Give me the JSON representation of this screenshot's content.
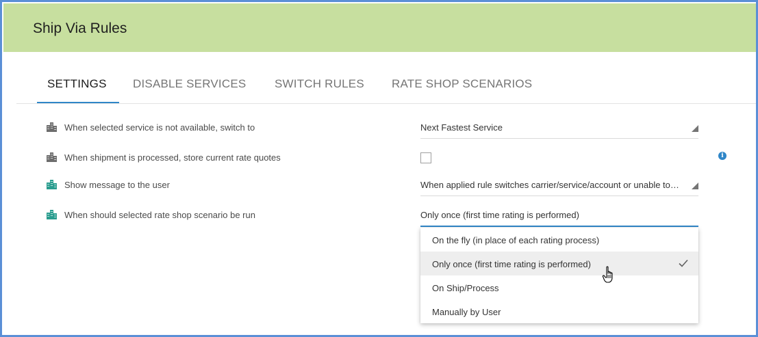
{
  "header": {
    "title": "Ship Via Rules"
  },
  "tabs": [
    {
      "label": "SETTINGS"
    },
    {
      "label": "DISABLE SERVICES"
    },
    {
      "label": "SWITCH RULES"
    },
    {
      "label": "RATE SHOP SCENARIOS"
    }
  ],
  "settings": [
    {
      "label": "When selected service is not available, switch to",
      "icon": "building-icon",
      "icon_color": "#6d6d6d",
      "control": "select",
      "value": "Next Fastest Service"
    },
    {
      "label": "When shipment is processed, store current rate quotes",
      "icon": "building-icon",
      "icon_color": "#6d6d6d",
      "control": "checkbox",
      "checked": false
    },
    {
      "label": "Show message to the user",
      "icon": "building-icon",
      "icon_color": "#2a9d8f",
      "control": "select",
      "value": "When applied rule switches carrier/service/account or unable to switch"
    },
    {
      "label": "When should selected rate shop scenario be run",
      "icon": "building-icon",
      "icon_color": "#2a9d8f",
      "control": "select",
      "value": "Only once (first time rating is performed)"
    }
  ],
  "info": {
    "icon": "info-icon",
    "glyph": "i"
  },
  "dropdown": {
    "options": [
      {
        "label": "On the fly (in place of each rating process)"
      },
      {
        "label": "Only once (first time rating is performed)",
        "selected": true
      },
      {
        "label": "On Ship/Process"
      },
      {
        "label": "Manually by User"
      }
    ]
  },
  "colors": {
    "header_bg": "#c7df9f",
    "accent": "#2f86c8",
    "border": "#5b8fd6"
  }
}
